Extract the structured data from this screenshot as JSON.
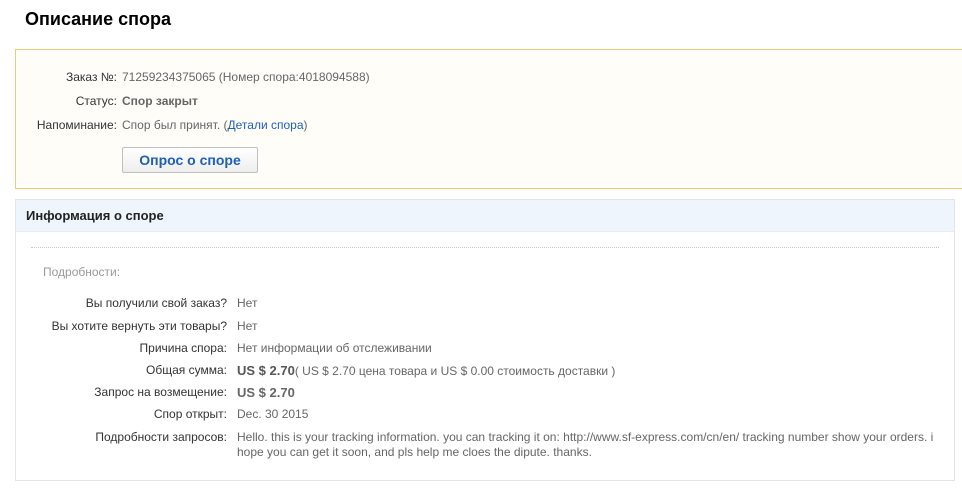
{
  "page": {
    "title": "Описание спора"
  },
  "status": {
    "order_label": "Заказ №:",
    "order_value": "71259234375065 (Номер спора:4018094588)",
    "status_label": "Статус:",
    "status_value": "Спор закрыт",
    "reminder_label": "Напоминание:",
    "reminder_text": "Спор был принят. (",
    "reminder_link": "Детали спора",
    "reminder_close": ")",
    "survey_button": "Опрос о споре"
  },
  "info": {
    "header": "Информация о споре",
    "details_caption": "Подробности:",
    "rows": [
      {
        "label": "Вы получили свой заказ?",
        "value": "Нет"
      },
      {
        "label": "Вы хотите вернуть эти товары?",
        "value": "Нет"
      },
      {
        "label": "Причина спора:",
        "value": "Нет информации об отслеживании"
      },
      {
        "label": "Общая сумма:",
        "value_strong": "US $ 2.70",
        "value_note": "( US $ 2.70 цена товара и US $ 0.00 стоимость доставки )"
      },
      {
        "label": "Запрос на возмещение:",
        "value": "US $ 2.70"
      },
      {
        "label": "Спор открыт:",
        "value": "Dec. 30 2015"
      },
      {
        "label": "Подробности запросов:",
        "value": "Hello. this is your tracking information. you can tracking it on: http://www.sf-express.com/cn/en/ tracking number show your orders. i hope you can get it soon, and pls help me cloes the dipute. thanks."
      }
    ]
  },
  "colors": {
    "status_closed": "#2f9e0e",
    "refund": "#e56b18",
    "link": "#1f5fb5"
  }
}
